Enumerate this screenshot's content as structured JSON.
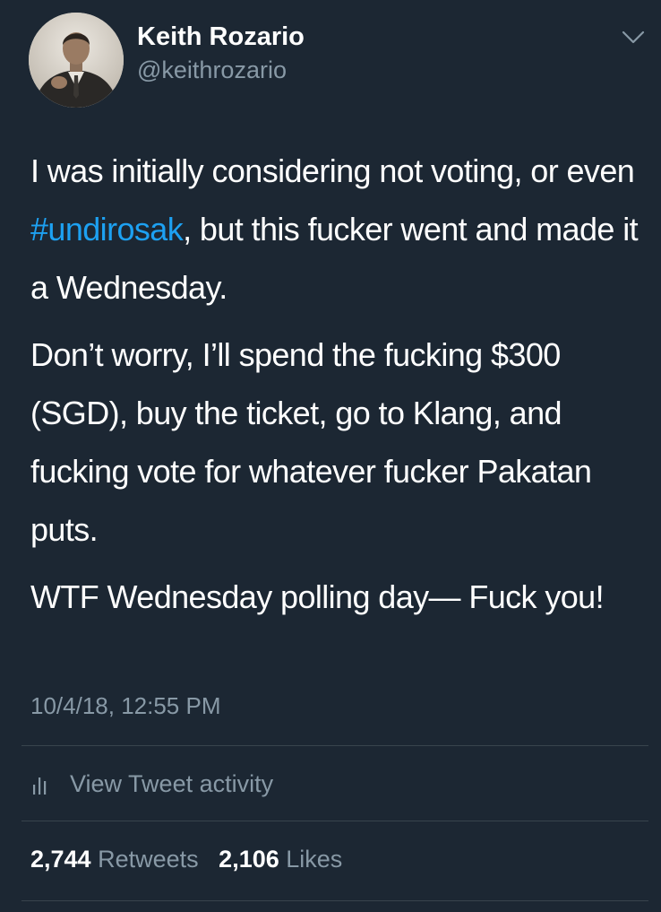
{
  "tweet": {
    "author": {
      "name": "Keith Rozario",
      "handle": "@keithrozario",
      "avatar": "profile-photo"
    },
    "menu_icon": "chevron-down-icon",
    "paragraphs": {
      "p1_before": "I was initially considering not voting, or even ",
      "p1_hashtag": "#undirosak",
      "p1_after": ", but this fucker went and made it a Wednesday.",
      "p2": "Don’t worry, I’ll spend the fucking $300 (SGD), buy the ticket, go to Klang, and fucking vote for whatever fucker Pakatan puts.",
      "p3": "WTF Wednesday polling day— Fuck you!"
    },
    "timestamp": "10/4/18, 12:55 PM",
    "activity": {
      "icon": "bar-chart-icon",
      "label": "View Tweet activity"
    },
    "stats": {
      "retweets_count": "2,744",
      "retweets_label": "Retweets",
      "likes_count": "2,106",
      "likes_label": "Likes"
    }
  },
  "colors": {
    "background": "#1c2733",
    "text_primary": "#ffffff",
    "text_secondary": "#8899a6",
    "hashtag": "#1da1f2",
    "divider": "#38444d"
  }
}
